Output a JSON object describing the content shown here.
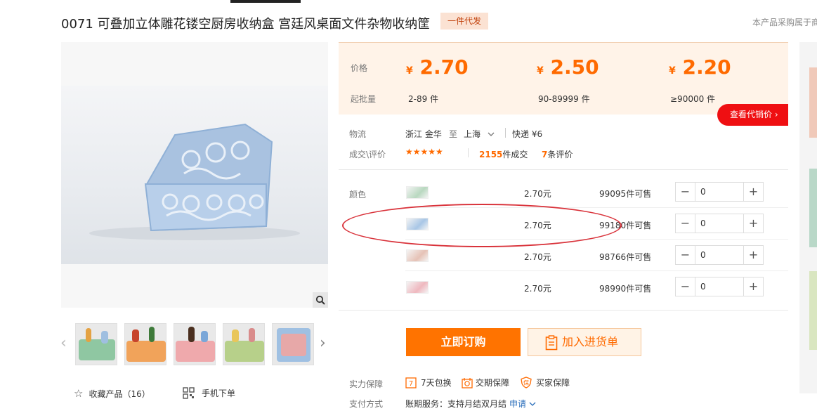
{
  "header": {
    "title": "0071 可叠加立体雕花镂空厨房收纳盒 宫廷风桌面文件杂物收纳筐",
    "tag": "一件代发",
    "note": "本产品采购属于商"
  },
  "gallery": {
    "favorite_label": "收藏产品（16）",
    "mobile_label": "手机下单"
  },
  "pricing": {
    "price_label": "价格",
    "moq_label": "起批量",
    "currency": "¥",
    "tiers": [
      {
        "price": "2.70",
        "range": "2-89 件"
      },
      {
        "price": "2.50",
        "range": "90-89999 件"
      },
      {
        "price": "2.20",
        "range": "≥90000 件"
      }
    ],
    "distributor_button": "查看代销价 ›"
  },
  "logistics": {
    "label": "物流",
    "from": "浙江 金华",
    "to_word": "至",
    "destination": "上海",
    "shipping": "快递 ¥6"
  },
  "reviews": {
    "label": "成交\\评价",
    "stars": "★★★★★",
    "deals_count": "2155",
    "deals_suffix": "件成交",
    "review_count": "7",
    "review_suffix": "条评价"
  },
  "variants": {
    "label": "颜色",
    "items": [
      {
        "price": "2.70元",
        "stock": "99095",
        "stock_suffix": "件可售",
        "qty": "0",
        "color": "#b9d8c0"
      },
      {
        "price": "2.70元",
        "stock": "99180",
        "stock_suffix": "件可售",
        "qty": "0",
        "color": "#a8c6e6"
      },
      {
        "price": "2.70元",
        "stock": "98766",
        "stock_suffix": "件可售",
        "qty": "0",
        "color": "#e6c2b6"
      },
      {
        "price": "2.70元",
        "stock": "98990",
        "stock_suffix": "件可售",
        "qty": "0",
        "color": "#efb8bf"
      }
    ]
  },
  "actions": {
    "order_now": "立即订购",
    "add_to_cart": "加入进货单"
  },
  "guarantee": {
    "label": "实力保障",
    "items": [
      "7天包换",
      "交期保障",
      "买家保障"
    ]
  },
  "payment": {
    "label": "支付方式",
    "text": "账期服务：支持月结双月结",
    "apply": "申请"
  },
  "colors": {
    "accent": "#ff6a00",
    "order_button": "#ff7300",
    "distributor_button": "#ef0f12",
    "annotation": "#d9333b"
  }
}
